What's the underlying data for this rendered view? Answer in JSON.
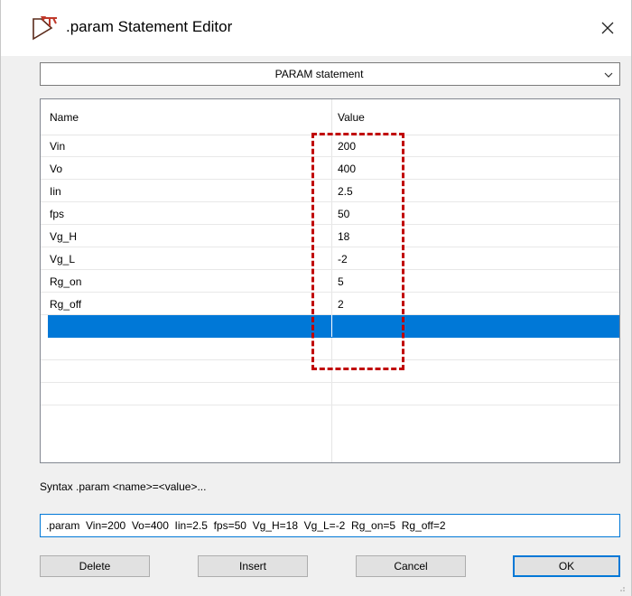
{
  "window": {
    "title": ".param Statement Editor",
    "app_icon": "app-logo-icon",
    "close_icon": "close-icon"
  },
  "statement_select": {
    "selected": "PARAM statement",
    "arrow_icon": "chevron-down-icon"
  },
  "grid": {
    "columns": [
      "Name",
      "Value"
    ],
    "rows": [
      {
        "name": "Vin",
        "value": "200"
      },
      {
        "name": "Vo",
        "value": "400"
      },
      {
        "name": "Iin",
        "value": "2.5"
      },
      {
        "name": "fps",
        "value": "50"
      },
      {
        "name": "Vg_H",
        "value": "18"
      },
      {
        "name": "Vg_L",
        "value": "-2"
      },
      {
        "name": "Rg_on",
        "value": "5"
      },
      {
        "name": "Rg_off",
        "value": "2"
      }
    ]
  },
  "syntax": {
    "text": "Syntax .param <name>=<value>..."
  },
  "statement_input": {
    "value": ".param  Vin=200  Vo=400  Iin=2.5  fps=50  Vg_H=18  Vg_L=-2  Rg_on=5  Rg_off=2"
  },
  "buttons": {
    "delete": "Delete",
    "insert": "Insert",
    "cancel": "Cancel",
    "ok": "OK"
  },
  "colors": {
    "selection": "#0078d7",
    "highlight_annotation": "#c00000",
    "dialog_bg": "#f0f0f0"
  }
}
